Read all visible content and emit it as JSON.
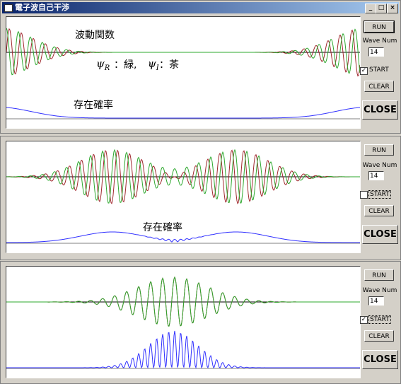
{
  "window": {
    "title": "電子波自己干渉",
    "controls": [
      "_",
      "□",
      "×"
    ]
  },
  "labels": {
    "wavefunction": "波動関数",
    "legend_r_sym": "ψ",
    "legend_r_sub": "R",
    "legend_r": "：緑,",
    "legend_i_sym": "ψ",
    "legend_i_sub": "I",
    "legend_i": "：茶",
    "probability": "存在確率"
  },
  "colors": {
    "psi_real": "#2ea82e",
    "psi_imag": "#a0282e",
    "probability": "#3030ff",
    "baseline": "#808080"
  },
  "panels": [
    {
      "run": "RUN",
      "wave_num_label": "Wave Num",
      "wave_num": "14",
      "start_label": "START",
      "start_checked": true,
      "clear": "CLEAR",
      "close": "CLOSE"
    },
    {
      "run": "RUN",
      "wave_num_label": "Wave Num",
      "wave_num": "14",
      "start_label": "START",
      "start_checked": false,
      "clear": "CLEAR",
      "close": "CLOSE"
    },
    {
      "run": "RUN",
      "wave_num_label": "Wave Num",
      "wave_num": "14",
      "start_label": "START",
      "start_checked": true,
      "clear": "CLEAR",
      "close": "CLOSE"
    }
  ]
}
